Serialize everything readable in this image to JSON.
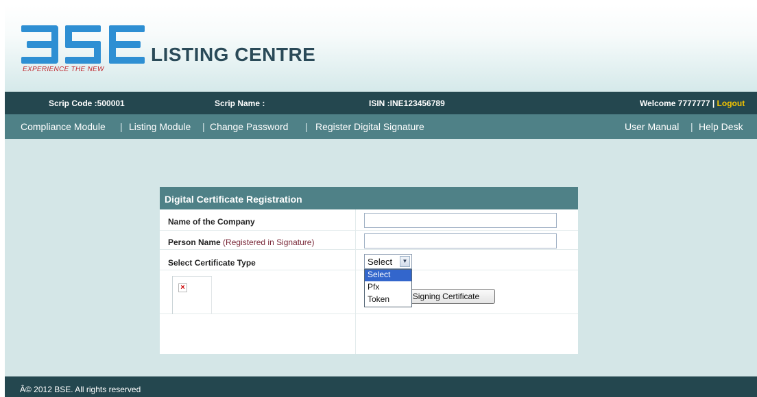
{
  "brand": {
    "logo_text": "BSE",
    "tagline": "EXPERIENCE THE NEW",
    "title": "LISTING CENTRE"
  },
  "infobar": {
    "scrip_code": "Scrip Code :500001",
    "scrip_name": "Scrip Name :",
    "isin": "ISIN :INE123456789",
    "welcome": "Welcome 7777777 | ",
    "logout": "Logout"
  },
  "menu": {
    "items": [
      "Compliance Module",
      "Listing Module",
      "Change Password",
      "Register Digital Signature"
    ],
    "right_items": [
      "User Manual",
      "Help Desk"
    ],
    "separator": "|"
  },
  "form": {
    "title": "Digital Certificate Registration",
    "company_label": "Name of the Company",
    "company_value": "",
    "person_label": "Person Name",
    "person_note": "(Registered in Signature)",
    "person_value": "",
    "cert_type_label": "Select Certificate Type",
    "cert_type_selected": "Select",
    "cert_type_options": [
      "Select",
      "Pfx",
      "Token"
    ],
    "signing_button": "Signing Certificate"
  },
  "footer": {
    "copyright": "Â© 2012 BSE. All rights reserved"
  },
  "colors": {
    "header_dark": "#24474f",
    "menu_teal": "#4f8187",
    "background": "#d4e6e7",
    "logo_blue": "#2e8fd3",
    "tagline_red": "#c0272d",
    "logout_yellow": "#f4c400",
    "selected_option": "#3366cc"
  },
  "icons": {
    "broken_image": "broken-image-icon",
    "dropdown_arrow": "chevron-down-icon"
  }
}
